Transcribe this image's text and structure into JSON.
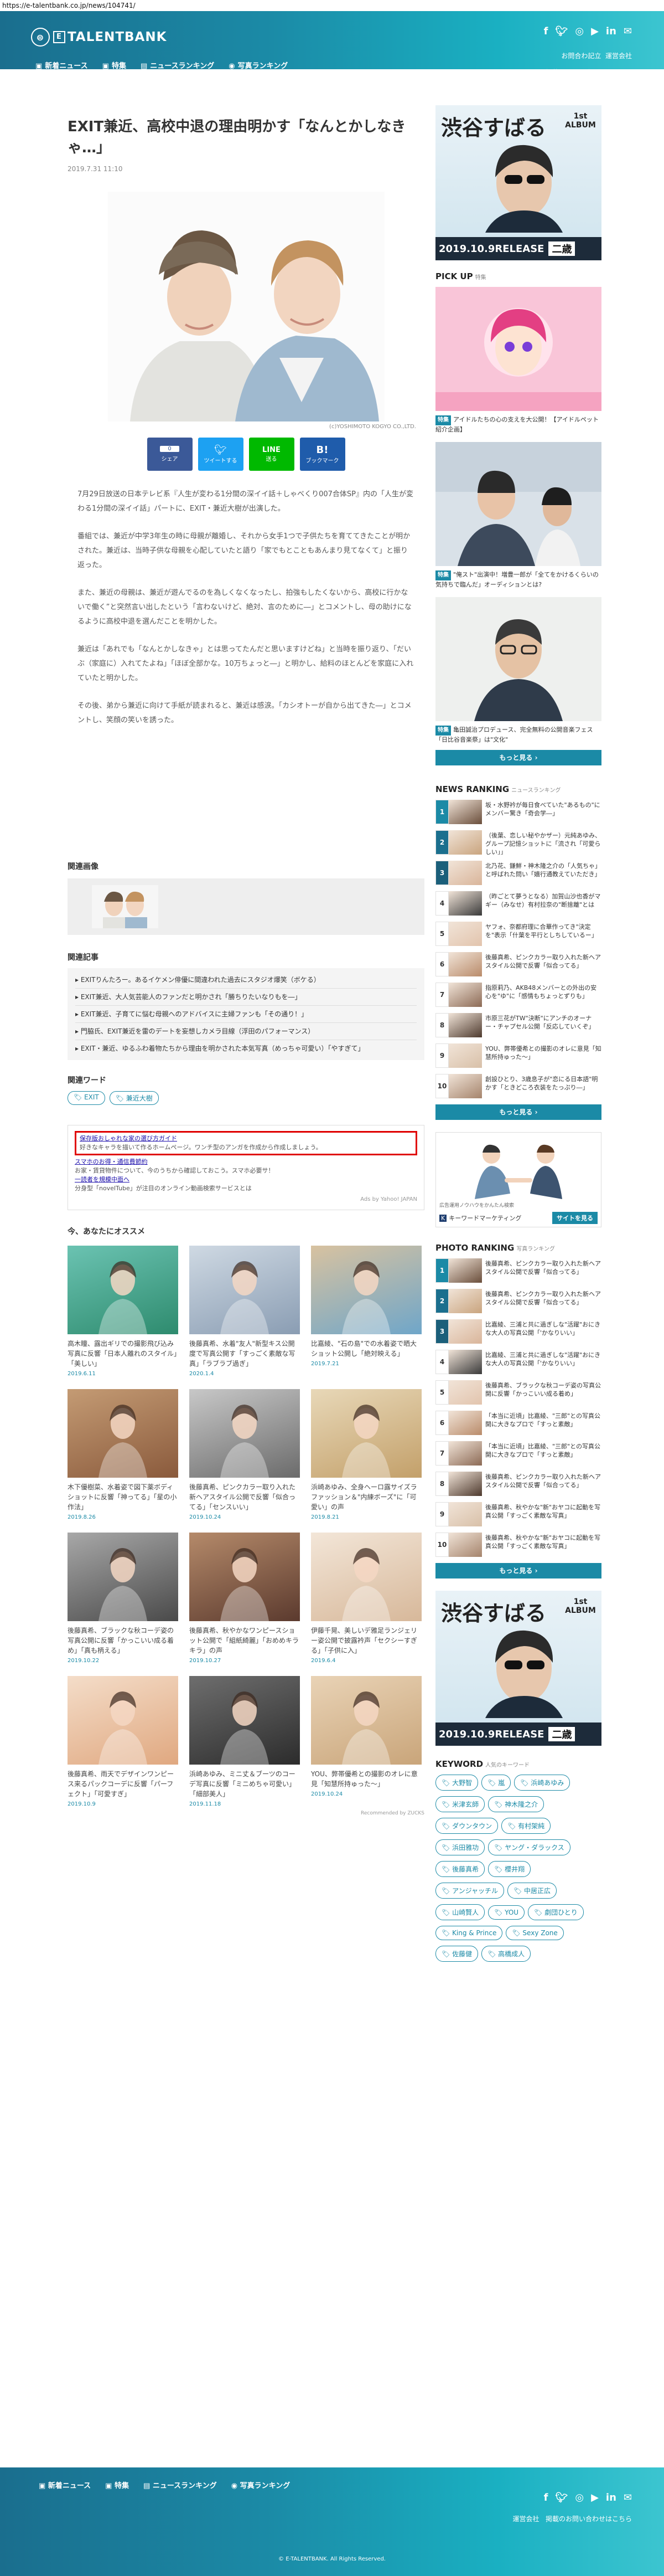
{
  "browser": {
    "url": "https://e-talentbank.co.jp/news/104741/"
  },
  "header": {
    "brand": "TALENTBANK",
    "nav": [
      {
        "icon": "document-icon",
        "label": "新着ニュース"
      },
      {
        "icon": "bookmark-icon",
        "label": "特集"
      },
      {
        "icon": "ranking-icon",
        "label": "ニュースランキング"
      },
      {
        "icon": "camera-icon",
        "label": "写真ランキング"
      }
    ],
    "social": [
      "f",
      "t",
      "ig",
      "yt",
      "in",
      "✉"
    ],
    "links": [
      "お問合わ記立",
      "運営会社",
      "掲載のお問い合わせはこちら"
    ]
  },
  "article": {
    "title": "EXIT兼近、高校中退の理由明かす「なんとかしなきゃ…」",
    "date": "2019.7.31 11:10",
    "photo_credit": "(c)YOSHIMOTO KOGYO CO.,LTD.",
    "share": [
      {
        "count": "0",
        "label": "シェア",
        "color": "#3b5998"
      },
      {
        "count": "",
        "label": "ツイートする",
        "color": "#1da1f2"
      },
      {
        "count": "",
        "label": "送る",
        "color": "#00b900"
      },
      {
        "count": "",
        "label": "ブックマーク",
        "color": "#1f5cab"
      }
    ],
    "paragraphs": [
      "7月29日放送の日本テレビ系『人生が変わる1分間の深イイ話＋しゃべくり007合体SP』内の「人生が変わる1分間の深イイ話」パートに、EXIT・兼近大樹が出演した。",
      "番組では、兼近が中学3年生の時に母親が離婚し、それから女手1つで子供たちを育ててきたことが明かされた。兼近は、当時子供な母親を心配していたと語り「家でもとこともあんまり見てなくて」と振り返った。",
      "また、兼近の母親は、兼近が遊んでるのを為しくなくなったし、拍強もしたくないから、高校に行かないで働く”と突然言い出したという「言わないけど、絶対、言のために―」とコメントし、母の助けになるように高校中退を選んだことを明かした。",
      "兼近は「あれでも「なんとかしなきゃ」とは思ってたんだと思いますけどね」と当時を振り返り、「だいぶ（家庭に）入れてたよね」「ほぼ全部かな。10万ちょっと―」と明かし、給料のほとんどを家庭に入れていたと明かした。",
      "その後、弟から兼近に向けて手紙が読まれると、兼近は感涙。「カシオトーが自から出てきた―」とコメントし、笑顔の笑いを誘った。"
    ]
  },
  "related": {
    "images_title": "関連画像",
    "articles_title": "関連記事",
    "articles": [
      "EXITりんたろー。あるイケメン俳優に間違われた過去にスタジオ爆笑（ボケる）",
      "EXIT兼近、大人気芸能人のファンだと明かされ「勝ちりたいなりもを―」",
      "EXIT兼近、子育てに悩む母親へのアドバイスに主婦ファンも「その通り！」",
      "門脇氏、EXIT兼近を雷のデートを妄想しカメラ目線（浮田のパフォーマンス）",
      "EXIT・兼近、ゆるふわ着物たちから理由を明かされた本気写真（めっちゃ可愛い）「やすぎて」"
    ],
    "words_title": "関連ワード",
    "words": [
      "EXIT",
      "兼近大樹"
    ]
  },
  "ads": {
    "lines": [
      "保存版おしゃれな家の選び方ガイド",
      "好きなキャラを描いて作るホームページ。ワンチ型のアンガを作成から作成しましょう。",
      "スマホのお得・通信費節約",
      "お家・賃貸物件について、今のうちから確認しておこう。スマホ必要サ！",
      "一読者を規模中面へ",
      "分身型「novelTube」が注目のオンライン動画検索サービスとは"
    ],
    "footer": "Ads by Yahoo! JAPAN"
  },
  "recommend": {
    "title": "今、あなたにオススメ",
    "footer": "Recommended by ZUCKS",
    "cards": [
      {
        "text": "高木瞳、露出ギリでの撮影飛び込み写真に反響「日本人離れのスタイル」「美しい」",
        "date": "2019.6.11",
        "c1": "#2e8b6e",
        "c2": "#6bc3b2"
      },
      {
        "text": "後藤真希、水着\"友人\"新型キス公開度で写真公開す「すっごく素敵な写真」「ラブラブ過ぎ」",
        "date": "2020.1.4",
        "c1": "#8a9db3",
        "c2": "#cfd9e3"
      },
      {
        "text": "比嘉綾、\"石の島\"での水着姿で晒大ショット公開し「絶対映える」",
        "date": "2019.7.21",
        "c1": "#6fa6c9",
        "c2": "#d8c2a0"
      },
      {
        "text": "木下優樹菜、水着姿で図下薬ボディショットに反響「神ってる」「星の小作法」",
        "date": "2019.8.26",
        "c1": "#8a5a3c",
        "c2": "#c49b74"
      },
      {
        "text": "後藤真希、ピンクカラー取り入れた新ヘアスタイル公開で反響「似合ってる」「センスいい」",
        "date": "2019.10.24",
        "c1": "#6b6b6b",
        "c2": "#c8c8c8"
      },
      {
        "text": "浜崎あゆみ、全身ヘーロ露サイズラファッション＆\"内練ボーズ\"に「可愛い」の声",
        "date": "2019.8.21",
        "c1": "#c3a06a",
        "c2": "#e8d8b8"
      },
      {
        "text": "後藤真希、ブラックな秋コーデ姿の写真公開に反響「かっこいい成る着め」「真も柄える」",
        "date": "2019.10.22",
        "c1": "#4a4a4a",
        "c2": "#a8a8a8"
      },
      {
        "text": "後藤真希、秋やかなワンピースショット公開で「組紙綺麗」「おめめキラキラ」の声",
        "date": "2019.10.27",
        "c1": "#5b3a2e",
        "c2": "#b58a6a"
      },
      {
        "text": "伊藤千晃、美しいデ雅足ランジェリー姿公開で披露衿声「セクシーすぎる」「子供に入」",
        "date": "2019.6.4",
        "c1": "#d7b89a",
        "c2": "#f3e6d8"
      },
      {
        "text": "後藤真希、雨天でデザインワンピース来るパックコーデに反響「パーフェクト」「可愛すぎ」",
        "date": "2019.10.9",
        "c1": "#e0a880",
        "c2": "#f4ddc9"
      },
      {
        "text": "浜崎あゆみ、ミニ丈＆ブーツのコーデ写真に反響「ミニめちゃ可愛い」「細部美人」",
        "date": "2019.11.18",
        "c1": "#2c2c2c",
        "c2": "#6e6e6e"
      },
      {
        "text": "YOU、弊帯優希との撮影のオレに意見「知慧所持ゅった～」",
        "date": "2019.10.24",
        "c1": "#c9a57a",
        "c2": "#e9d3b6"
      }
    ]
  },
  "sidebar": {
    "album_text": "渋谷すばる",
    "album_sub": "1st ALBUM",
    "album_release": "2019.10.9RELEASE",
    "album_title": "二歳",
    "pickup": {
      "title": "PICK UP",
      "subtitle": "特集",
      "items": [
        {
          "tag": "特集",
          "text": "アイドルたちの心の支えを大公開！【アイドルペット紹介企画】"
        },
        {
          "tag": "特集",
          "text": "\"俺スト\"出演中！増豊一郎が「全てをかけるくらいの気持ちで臨んだ」オーディションとは?"
        },
        {
          "tag": "特集",
          "text": "亀田誠治プロデュース、完全無料の公開音楽フェス「日比谷音楽祭」は\"文化\""
        }
      ],
      "more": "もっと見る"
    },
    "news_ranking": {
      "title": "NEWS RANKING",
      "subtitle": "ニュースランキング",
      "items": [
        "坂・水野衿が毎日食べていた\"あるもの\"にメンバー驚き「奇会学―」",
        "（後葉、恋しい秘やかザー）元純あゆみ、グループ記憶ショットに「流され「可愛らしい」」",
        "北乃花、鎌鮮・神木隆之介の「人気ちゃ」と呼ばれた問い「嬉行通教えていただき」",
        "（昨ごとて夢うとなる）加賀山沙也香がマギー（みなせ）有村拉奈の\"断捨離\"とは",
        "ヤフォ、奈都府理に合華作ってき\"決定を\"表示「什葉を平行としちしているー」",
        "後藤真希、ピンクカラー取り入れた新ヘアスタイル公開で反響「似合ってる」",
        "指原莉乃、AKB48メンバーとの外出の安心を\"ゆ\"に「感情もちょっとずりも」",
        "市原三花がTW\"決断\"にアンチのオーナー・チャプセル公開「反応していくぞ」",
        "YOU、弊帯優希との撮影のオレに意見「知慧所持ゅった～」",
        "創設ひとり、3歳息子が\"恋にる日本語\"明かす「ときどころ衣装をたっぷり―」"
      ]
    },
    "ad2": {
      "label": "広告運用ノウハウをかんたん検索",
      "keyword": "キーワードマーケティング",
      "button": "サイトを見る"
    },
    "photo_ranking": {
      "title": "PHOTO RANKING",
      "subtitle": "写真ランキング",
      "items": [
        "後藤真希、ピンクカラー取り入れた新ヘアスタイル公開で反響「似合ってる」",
        "後藤真希、ピンクカラー取り入れた新ヘアスタイル公開で反響「似合ってる」",
        "比嘉綾、三浦と共に過ぎしな\"活躍\"おにきな大人の写真公開「'かなりいい」",
        "比嘉綾、三浦と共に過ぎしな\"活躍\"おにきな大人の写真公開「'かなりいい」",
        "後藤真希、ブラックな秋コーデ姿の写真公開に反響「かっこいい成る着め」",
        "「本当に近頃」比嘉綾、\"三郎\"との写真公開に大きなプロで「すっと素敵」",
        "「本当に近頃」比嘉綾、\"三郎\"との写真公開に大きなプロで「すっと素敵」",
        "後藤真希、ピンクカラー取り入れた新ヘアスタイル公開で反響「似合ってる」",
        "後藤真希、秋やかな\"新\"おヤコに起動を写真公開「すっごく素敵な写真」",
        "後藤真希、秋やかな\"新\"おヤコに起動を写真公開「すっごく素敵な写真」"
      ]
    },
    "keywords": {
      "title": "KEYWORD",
      "subtitle": "人気のキーワード",
      "items": [
        "大野智",
        "嵐",
        "浜崎あゆみ",
        "米津玄師",
        "神木隆之介",
        "ダウンタウン",
        "有村架純",
        "浜田雅功",
        "ヤング・ダラックス",
        "後藤真希",
        "櫻井翔",
        "アンジャッチル",
        "中居正広",
        "山崎賢人",
        "YOU",
        "劇団ひとり",
        "King & Prince",
        "Sexy Zone",
        "佐藤健",
        "高橋成人"
      ]
    }
  },
  "footer": {
    "nav": [
      {
        "icon": "document-icon",
        "label": "新着ニュース"
      },
      {
        "icon": "bookmark-icon",
        "label": "特集"
      },
      {
        "icon": "ranking-icon",
        "label": "ニュースランキング"
      },
      {
        "icon": "camera-icon",
        "label": "写真ランキング"
      }
    ],
    "links": [
      "運営会社",
      "掲載のお問い合わせはこちら"
    ],
    "copyright": "© E-TALENTBANK. All Rights Reserved."
  },
  "colors": {
    "brand": "#1b8aa6",
    "red_box": "#e00000",
    "rank_dark": "#1b5f7a"
  }
}
